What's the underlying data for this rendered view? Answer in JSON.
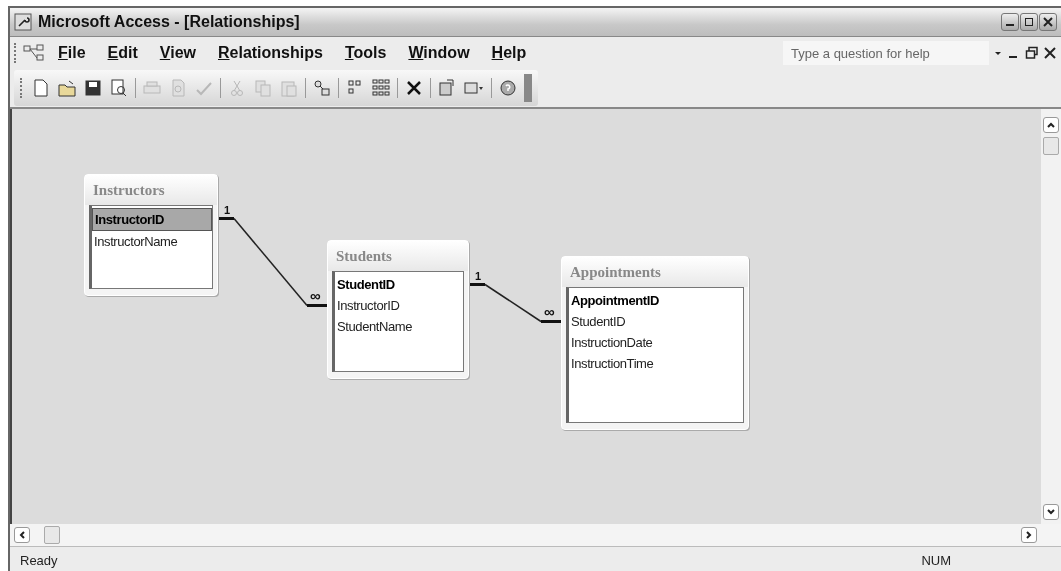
{
  "window": {
    "title": "Microsoft Access - [Relationships]"
  },
  "menu": [
    {
      "label": "File"
    },
    {
      "label": "Edit"
    },
    {
      "label": "View"
    },
    {
      "label": "Relationships"
    },
    {
      "label": "Tools"
    },
    {
      "label": "Window"
    },
    {
      "label": "Help"
    }
  ],
  "help_box": {
    "placeholder": "Type a question for help"
  },
  "toolbar": [
    {
      "kind": "icon",
      "disabled": false
    },
    {
      "kind": "icon",
      "disabled": false
    },
    {
      "kind": "icon",
      "disabled": false
    },
    {
      "kind": "icon",
      "disabled": false
    },
    {
      "kind": "separator"
    },
    {
      "kind": "icon",
      "disabled": true
    },
    {
      "kind": "icon",
      "disabled": true
    },
    {
      "kind": "icon",
      "disabled": true
    },
    {
      "kind": "separator"
    },
    {
      "kind": "icon",
      "disabled": true
    },
    {
      "kind": "icon",
      "disabled": true
    },
    {
      "kind": "icon",
      "disabled": true
    },
    {
      "kind": "separator"
    },
    {
      "kind": "icon",
      "disabled": false
    },
    {
      "kind": "separator"
    },
    {
      "kind": "icon",
      "disabled": false
    },
    {
      "kind": "icon",
      "disabled": false
    },
    {
      "kind": "separator"
    },
    {
      "kind": "icon",
      "disabled": false
    },
    {
      "kind": "separator"
    },
    {
      "kind": "icon",
      "disabled": false
    },
    {
      "kind": "icon",
      "disabled": false
    },
    {
      "kind": "separator"
    },
    {
      "kind": "icon",
      "disabled": false
    }
  ],
  "tables": [
    {
      "name": "Instructors",
      "fields": [
        {
          "name": "InstructorID",
          "primary": true,
          "selected": true,
          "one_end": true
        },
        {
          "name": "InstructorName",
          "primary": false,
          "selected": false
        }
      ]
    },
    {
      "name": "Students",
      "fields": [
        {
          "name": "StudentID",
          "primary": true,
          "selected": false,
          "one_end": true
        },
        {
          "name": "InstructorID",
          "primary": false,
          "selected": false,
          "many_end": true
        },
        {
          "name": "StudentName",
          "primary": false,
          "selected": false
        }
      ]
    },
    {
      "name": "Appointments",
      "fields": [
        {
          "name": "AppointmentID",
          "primary": true,
          "selected": false
        },
        {
          "name": "StudentID",
          "primary": false,
          "selected": false,
          "many_end": true
        },
        {
          "name": "InstructionDate",
          "primary": false,
          "selected": false
        },
        {
          "name": "InstructionTime",
          "primary": false,
          "selected": false
        }
      ]
    }
  ],
  "relationships": [
    {
      "one_label": "1",
      "many_label": "∞"
    },
    {
      "one_label": "1",
      "many_label": "∞"
    }
  ],
  "status_bar": {
    "text": "Ready",
    "indicator": "NUM"
  }
}
